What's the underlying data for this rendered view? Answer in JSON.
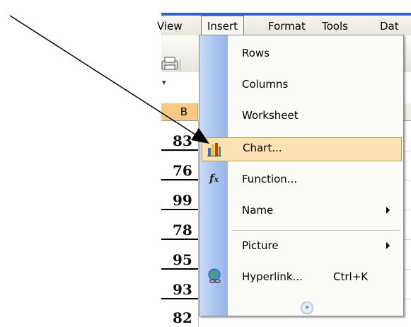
{
  "menubar": {
    "view": "View",
    "insert": "Insert",
    "format": "Format",
    "tools": "Tools",
    "data": "Dat"
  },
  "sheet": {
    "column_header": "B",
    "values": [
      "83",
      "76",
      "99",
      "78",
      "95",
      "93",
      "82"
    ]
  },
  "insert_menu": {
    "items": [
      {
        "label": "Rows",
        "icon": "none"
      },
      {
        "label": "Columns",
        "icon": "none"
      },
      {
        "label": "Worksheet",
        "icon": "none"
      },
      {
        "label": "Chart...",
        "icon": "bar-chart-icon",
        "highlighted": true
      },
      {
        "label": "Function...",
        "icon": "function-fx-icon"
      },
      {
        "label": "Name",
        "icon": "none",
        "submenu": true
      },
      {
        "label": "Picture",
        "icon": "none",
        "submenu": true
      },
      {
        "label": "Hyperlink...",
        "icon": "hyperlink-globe-icon",
        "shortcut": "Ctrl+K"
      }
    ],
    "expand_icon": "double-chevron-down-icon"
  },
  "colors": {
    "highlight": "#fde3b4",
    "highlight_border": "#c79a47",
    "icon_strip": "#a8c2ed",
    "column_header_selected": "#f7c983",
    "title_blue": "#2f63d0"
  }
}
